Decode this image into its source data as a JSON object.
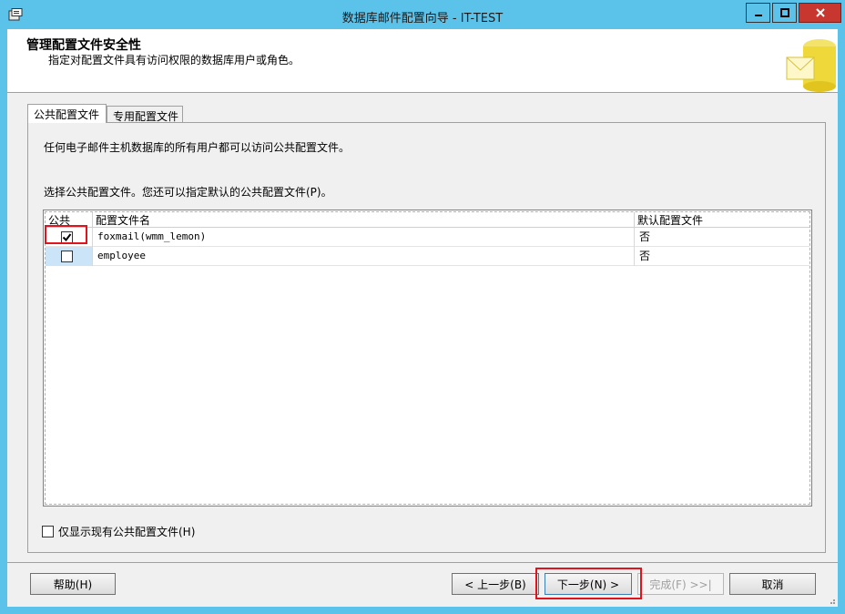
{
  "window": {
    "title": "数据库邮件配置向导 - IT-TEST",
    "accent": "#5bc2ea",
    "close_color": "#c7372f"
  },
  "header": {
    "title": "管理配置文件安全性",
    "subtitle": "指定对配置文件具有访问权限的数据库用户或角色。"
  },
  "tabs": [
    {
      "label": "公共配置文件",
      "active": true
    },
    {
      "label": "专用配置文件",
      "active": false
    }
  ],
  "panel": {
    "info_text": "任何电子邮件主机数据库的所有用户都可以访问公共配置文件。",
    "select_text": "选择公共配置文件。您还可以指定默认的公共配置文件(P)。"
  },
  "grid": {
    "columns": [
      "公共",
      "配置文件名",
      "默认配置文件"
    ],
    "rows": [
      {
        "public": true,
        "name": "foxmail(wmm_lemon)",
        "default": "否"
      },
      {
        "public": false,
        "name": "employee",
        "default": "否"
      }
    ]
  },
  "only_public_checkbox": {
    "label": "仅显示现有公共配置文件(H)",
    "checked": false
  },
  "buttons": {
    "help": "帮助(H)",
    "back": "< 上一步(B)",
    "next": "下一步(N) >",
    "finish": "完成(F) >>|",
    "cancel": "取消"
  },
  "highlight_color": "#e0141e"
}
